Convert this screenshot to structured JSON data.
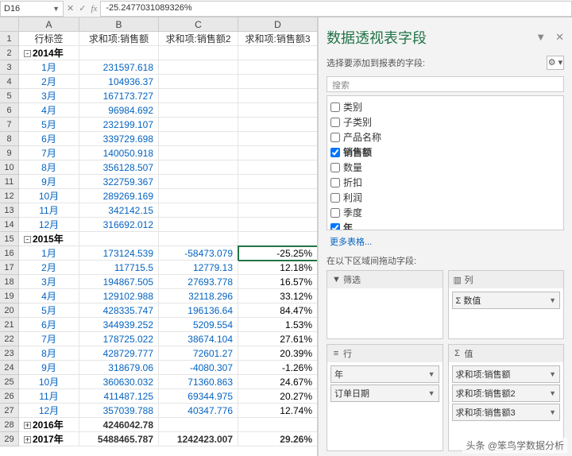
{
  "formula_bar": {
    "name_box": "D16",
    "formula": "-25.2477031089326%"
  },
  "columns": [
    "",
    "A",
    "B",
    "C",
    "D"
  ],
  "header_row": [
    "行标签",
    "求和项:销售额",
    "求和项:销售额2",
    "求和项:销售额3"
  ],
  "rows": [
    {
      "n": 2,
      "type": "grp",
      "exp": "-",
      "a": "2014年"
    },
    {
      "n": 3,
      "a": "1月",
      "b": "231597.618"
    },
    {
      "n": 4,
      "a": "2月",
      "b": "104936.37"
    },
    {
      "n": 5,
      "a": "3月",
      "b": "167173.727"
    },
    {
      "n": 6,
      "a": "4月",
      "b": "96984.692"
    },
    {
      "n": 7,
      "a": "5月",
      "b": "232199.107"
    },
    {
      "n": 8,
      "a": "6月",
      "b": "339729.698"
    },
    {
      "n": 9,
      "a": "7月",
      "b": "140050.918"
    },
    {
      "n": 10,
      "a": "8月",
      "b": "356128.507"
    },
    {
      "n": 11,
      "a": "9月",
      "b": "322759.367"
    },
    {
      "n": 12,
      "a": "10月",
      "b": "289269.169"
    },
    {
      "n": 13,
      "a": "11月",
      "b": "342142.15"
    },
    {
      "n": 14,
      "a": "12月",
      "b": "316692.012"
    },
    {
      "n": 15,
      "type": "grp",
      "exp": "-",
      "a": "2015年"
    },
    {
      "n": 16,
      "a": "1月",
      "b": "173124.539",
      "c": "-58473.079",
      "d": "-25.25%",
      "active": true
    },
    {
      "n": 17,
      "a": "2月",
      "b": "117715.5",
      "c": "12779.13",
      "d": "12.18%"
    },
    {
      "n": 18,
      "a": "3月",
      "b": "194867.505",
      "c": "27693.778",
      "d": "16.57%"
    },
    {
      "n": 19,
      "a": "4月",
      "b": "129102.988",
      "c": "32118.296",
      "d": "33.12%"
    },
    {
      "n": 20,
      "a": "5月",
      "b": "428335.747",
      "c": "196136.64",
      "d": "84.47%"
    },
    {
      "n": 21,
      "a": "6月",
      "b": "344939.252",
      "c": "5209.554",
      "d": "1.53%"
    },
    {
      "n": 22,
      "a": "7月",
      "b": "178725.022",
      "c": "38674.104",
      "d": "27.61%"
    },
    {
      "n": 23,
      "a": "8月",
      "b": "428729.777",
      "c": "72601.27",
      "d": "20.39%"
    },
    {
      "n": 24,
      "a": "9月",
      "b": "318679.06",
      "c": "-4080.307",
      "d": "-1.26%"
    },
    {
      "n": 25,
      "a": "10月",
      "b": "360630.032",
      "c": "71360.863",
      "d": "24.67%"
    },
    {
      "n": 26,
      "a": "11月",
      "b": "411487.125",
      "c": "69344.975",
      "d": "20.27%"
    },
    {
      "n": 27,
      "a": "12月",
      "b": "357039.788",
      "c": "40347.776",
      "d": "12.74%"
    },
    {
      "n": 28,
      "type": "grp",
      "exp": "+",
      "a": "2016年",
      "b": "4246042.78"
    },
    {
      "n": 29,
      "type": "grp",
      "exp": "+",
      "a": "2017年",
      "b": "5488465.787",
      "c": "1242423.007",
      "d": "29.26%"
    }
  ],
  "pane": {
    "title": "数据透视表字段",
    "subtitle": "选择要添加到报表的字段:",
    "search_placeholder": "搜索",
    "fields": [
      {
        "label": "类别",
        "checked": false
      },
      {
        "label": "子类别",
        "checked": false
      },
      {
        "label": "产品名称",
        "checked": false
      },
      {
        "label": "销售额",
        "checked": true,
        "bold": true
      },
      {
        "label": "数量",
        "checked": false
      },
      {
        "label": "折扣",
        "checked": false
      },
      {
        "label": "利润",
        "checked": false
      },
      {
        "label": "季度",
        "checked": false
      },
      {
        "label": "年",
        "checked": true,
        "bold": true
      }
    ],
    "more": "更多表格...",
    "areas_label": "在以下区域间拖动字段:",
    "filter_label": "筛选",
    "columns_label": "列",
    "rows_label": "行",
    "values_label": "值",
    "col_items": [
      "Σ 数值"
    ],
    "row_items": [
      "年",
      "订单日期"
    ],
    "val_items": [
      "求和项:销售额",
      "求和项:销售额2",
      "求和项:销售额3"
    ]
  },
  "watermark": "头条 @笨鸟学数据分析"
}
